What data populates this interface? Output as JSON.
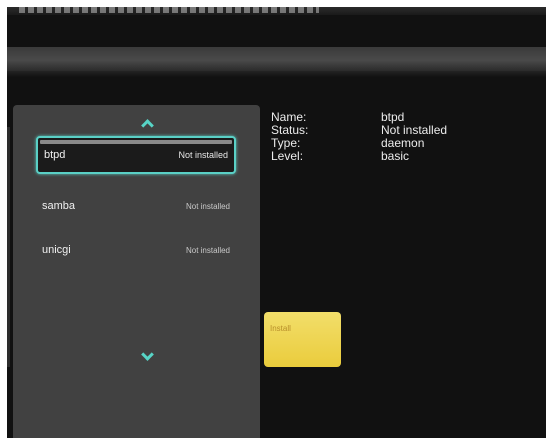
{
  "packages": [
    {
      "name": "btpd",
      "status": "Not installed",
      "selected": true
    },
    {
      "name": "samba",
      "status": "Not installed",
      "selected": false
    },
    {
      "name": "unicgi",
      "status": "Not installed",
      "selected": false
    }
  ],
  "details": {
    "name_label": "Name:",
    "name_value": "btpd",
    "status_label": "Status:",
    "status_value": "Not installed",
    "type_label": "Type:",
    "type_value": "daemon",
    "level_label": "Level:",
    "level_value": "basic"
  },
  "actions": {
    "install_label": "Install"
  },
  "icons": {
    "scroll_up": "chevron-up-icon",
    "scroll_down": "chevron-down-icon"
  },
  "colors": {
    "accent": "#5ad0c6",
    "button": "#f0d95a"
  }
}
